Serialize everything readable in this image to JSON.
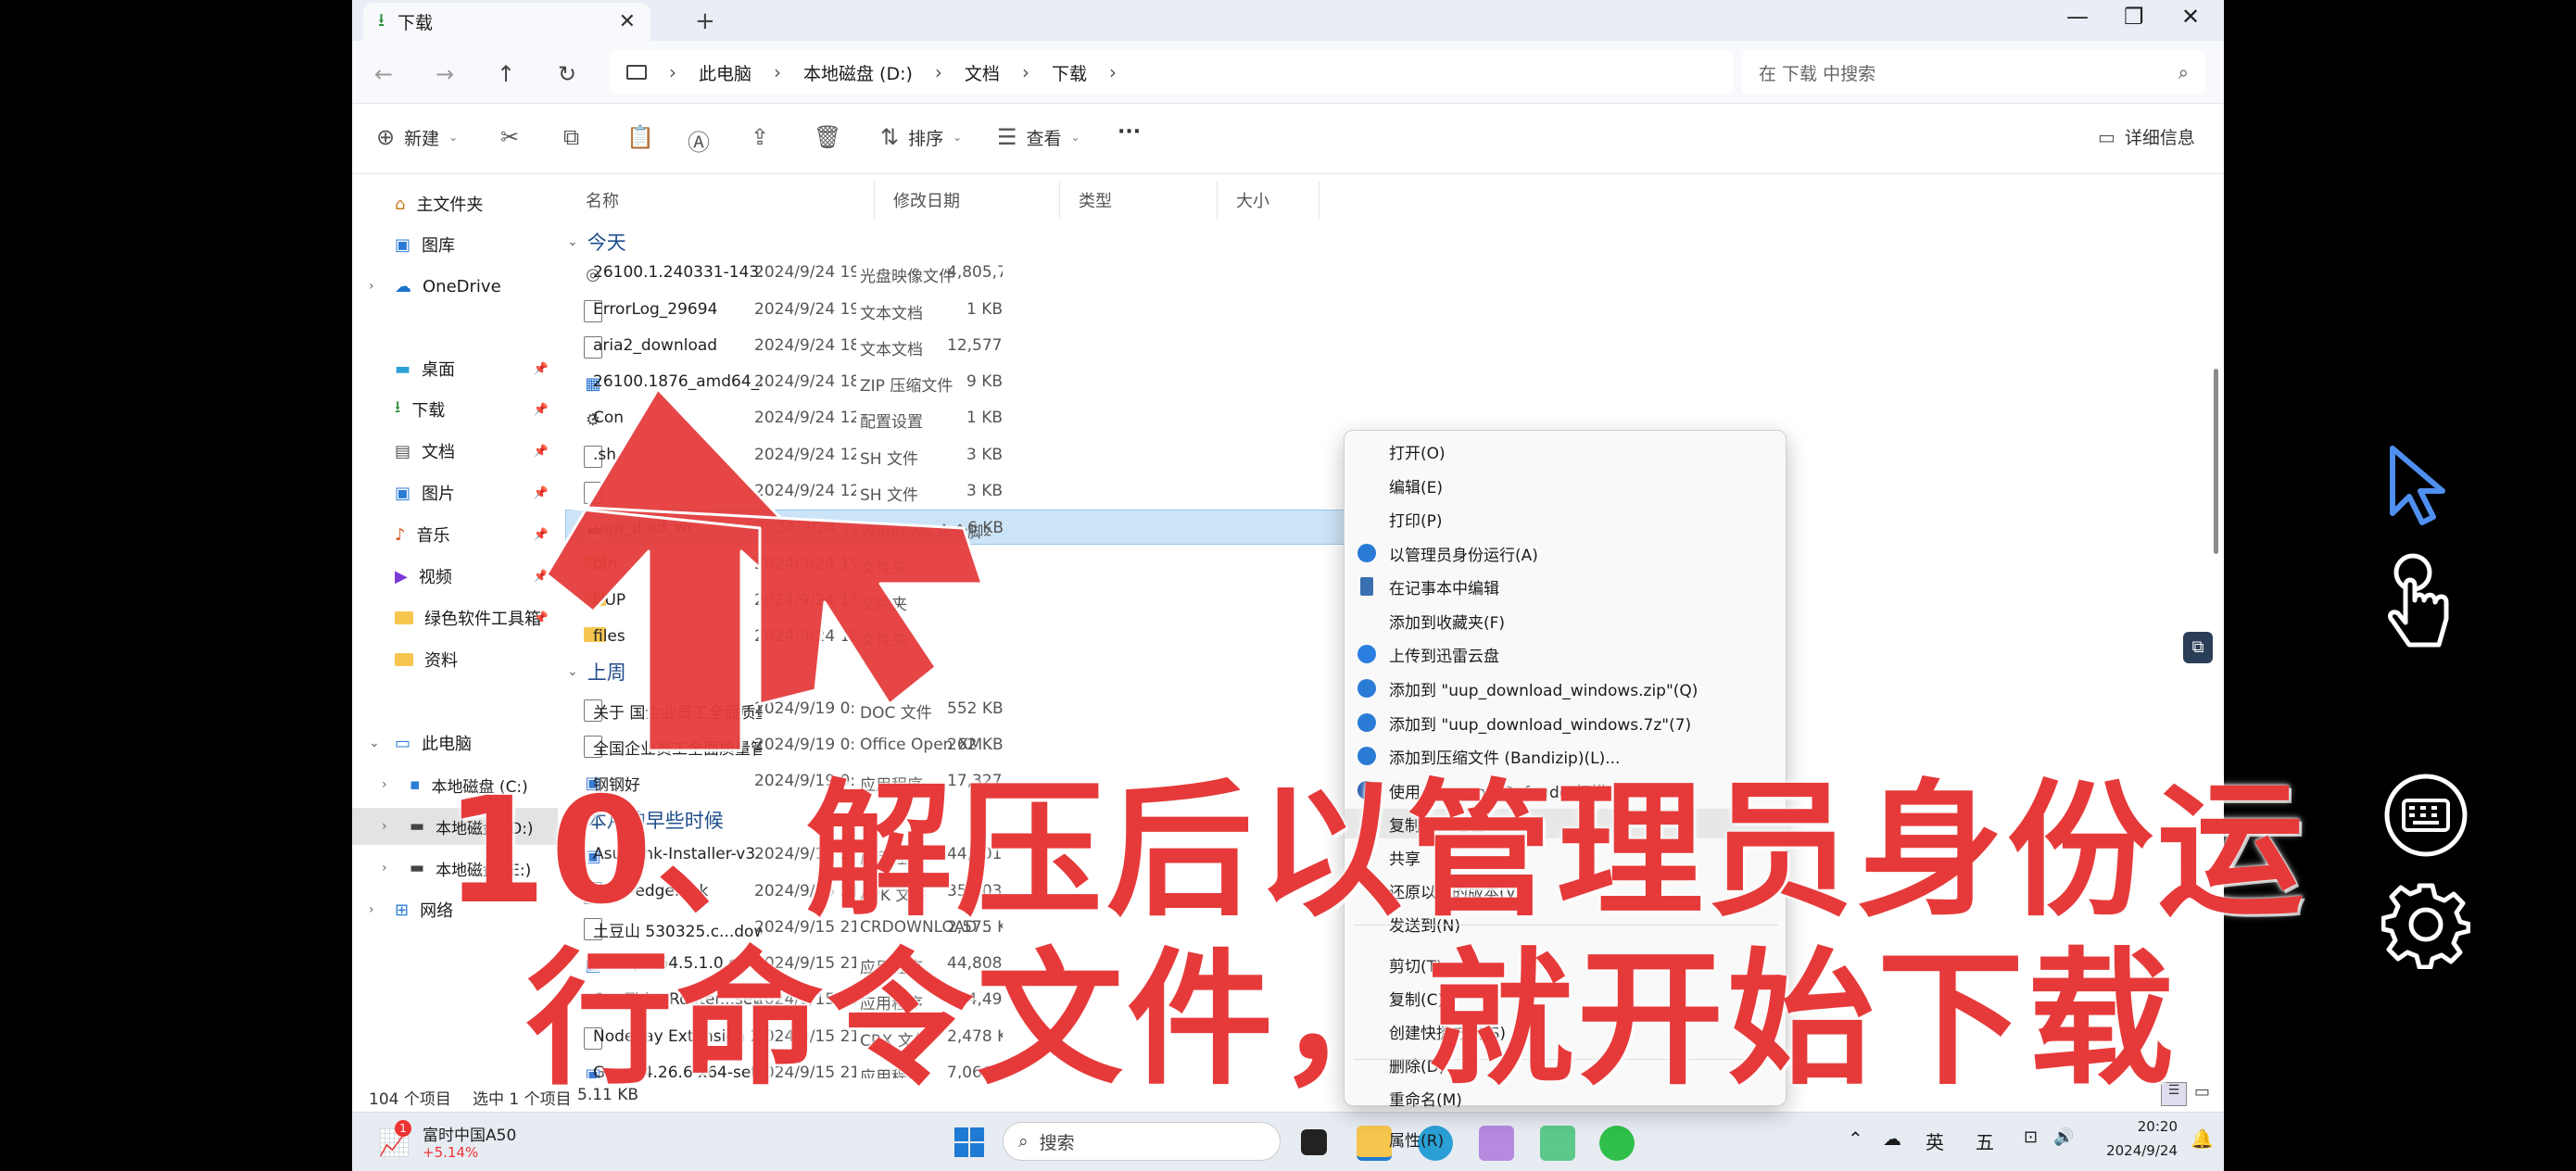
{
  "tab": {
    "title": "下载",
    "close": "✕",
    "new": "+"
  },
  "window_controls": {
    "minimize": "—",
    "maximize": "❐",
    "close": "✕"
  },
  "breadcrumb": [
    "此电脑",
    "本地磁盘 (D:)",
    "文档",
    "下载"
  ],
  "search": {
    "placeholder": "在 下载 中搜索"
  },
  "commands": {
    "new": "新建",
    "sort": "排序",
    "view": "查看",
    "more": "···",
    "details": "详细信息"
  },
  "sidebar": {
    "items": [
      {
        "label": "主文件夹",
        "icon": "home-icon"
      },
      {
        "label": "图库",
        "icon": "gallery-icon"
      },
      {
        "label": "OneDrive",
        "icon": "cloud-icon"
      },
      {
        "label": "桌面",
        "icon": "desktop-icon"
      },
      {
        "label": "下载",
        "icon": "download-icon"
      },
      {
        "label": "文档",
        "icon": "document-icon"
      },
      {
        "label": "图片",
        "icon": "picture-icon"
      },
      {
        "label": "音乐",
        "icon": "music-icon"
      },
      {
        "label": "视频",
        "icon": "video-icon"
      },
      {
        "label": "绿色软件工具箱",
        "icon": "folder-icon"
      },
      {
        "label": "资料",
        "icon": "folder-icon"
      },
      {
        "label": "此电脑",
        "icon": "pc-icon"
      },
      {
        "label": "本地磁盘 (C:)",
        "icon": "drive-icon"
      },
      {
        "label": "本地磁盘 (D:)",
        "icon": "drive-icon"
      },
      {
        "label": "本地磁盘 (E:)",
        "icon": "drive-icon"
      },
      {
        "label": "网络",
        "icon": "network-icon"
      }
    ]
  },
  "columns": {
    "name": "名称",
    "date": "修改日期",
    "type": "类型",
    "size": "大小"
  },
  "groups": {
    "today": "今天",
    "last_week": "上周",
    "earlier": "本月的早些时候"
  },
  "files": [
    {
      "name": "26100.1.240331-1435.GE_RELEASE_CL...",
      "date": "2024/9/24 19:13",
      "type": "光盘映像文件",
      "size": "4,805,720..."
    },
    {
      "name": "ErrorLog_29694",
      "date": "2024/9/24 19:02",
      "type": "文本文档",
      "size": "1 KB"
    },
    {
      "name": "aria2_download",
      "date": "2024/9/24 18:23",
      "type": "文本文档",
      "size": "12,577 KB"
    },
    {
      "name": "26100.1876_amd64_zh-cn_multi_009c...",
      "date": "2024/9/24 18:14",
      "type": "ZIP 压缩文件",
      "size": "9 KB"
    },
    {
      "name": "Con",
      "date": "2024/9/24 12:14",
      "type": "配置设置",
      "size": "1 KB"
    },
    {
      "name": ".sh",
      "date": "2024/9/24 12:14",
      "type": "SH 文件",
      "size": "3 KB"
    },
    {
      "name": "",
      "date": "2024/9/24 12:14",
      "type": "SH 文件",
      "size": "3 KB"
    },
    {
      "name": "uup_d   ad_wi",
      "date": "2024/9/24 12:14",
      "type": "Windows 命令脚本",
      "size": "6 KB"
    },
    {
      "name": "bin",
      "date": "2024/9/24 19:13",
      "type": "文件夹",
      "size": ""
    },
    {
      "name": "UUP",
      "date": "2024/9/24 18:31",
      "type": "文件夹",
      "size": ""
    },
    {
      "name": "files",
      "date": "2024/9/24 18:19",
      "type": "文件夹",
      "size": ""
    },
    {
      "name": "关于  国企业员工全面质量管理知识",
      "date": "2024/9/19 0:28",
      "type": "DOC 文件",
      "size": "552 KB"
    },
    {
      "name": "全国企业员工全面质量管理知识竞赛复习",
      "date": "2024/9/19 0:28",
      "type": "Office Open XM...",
      "size": "262 KB"
    },
    {
      "name": "钢钢好",
      "date": "2024/9/19 0:14",
      "type": "应用程序",
      "size": "17,327 KB"
    },
    {
      "name": "AsusLink-Installer-v3.5...",
      "date": "2024/9/15 22:54",
      "type": "应用程序",
      "size": "44,701 KB"
    },
    {
      "name": "titan-edge.apk",
      "date": "2024/9/15 21:52",
      "type": "APK 文件",
      "size": "359,033 KB"
    },
    {
      "name": "土豆山 530325.c...download",
      "date": "2024/9/15 21:58",
      "type": "CRDOWNLOAD ...",
      "size": "2,575 KB"
    },
    {
      "name": "tsetup-x64.5.1.0.exe",
      "date": "2024/9/15 21:44",
      "type": "应用程序",
      "size": "44,808 KB"
    },
    {
      "name": "OneThingRouter...setup_pc-One...",
      "date": "2024/9/15 21:18",
      "type": "应用程序",
      "size": "224,492 KB"
    },
    {
      "name": "Nodepay Extension 2.2.7.crx",
      "date": "2024/9/15 21:12",
      "type": "CRX 文件",
      "size": "2,478 KB"
    },
    {
      "name": "Grass 4.26.6 x64-setup",
      "date": "2024/9/15 21:03",
      "type": "应用程序",
      "size": "7,066 KB"
    }
  ],
  "status": {
    "count": "104 个项目",
    "selected": "选中 1 个项目",
    "size": "5.11 KB"
  },
  "context_menu": [
    {
      "label": "打开(O)",
      "icon": ""
    },
    {
      "label": "编辑(E)",
      "icon": ""
    },
    {
      "label": "打印(P)",
      "icon": ""
    },
    {
      "label": "以管理员身份运行(A)",
      "icon": "shield-icon"
    },
    {
      "label": "在记事本中编辑",
      "icon": "notepad-icon"
    },
    {
      "label": "添加到收藏夹(F)",
      "icon": ""
    },
    {
      "label": "上传到迅雷云盘",
      "icon": "thunder-icon"
    },
    {
      "label": "添加到 \"uup_download_windows.zip\"(Q)",
      "icon": "bandizip-icon"
    },
    {
      "label": "添加到 \"uup_download_windows.7z\"(7)",
      "icon": "bandizip-icon"
    },
    {
      "label": "添加到压缩文件 (Bandizip)(L)...",
      "icon": "bandizip-icon"
    },
    {
      "label": "使用 Microsoft Defender扫描...",
      "icon": "defender-icon"
    },
    {
      "label": "复制文件地址",
      "icon": ""
    },
    {
      "label": "共享",
      "icon": ""
    },
    {
      "label": "还原以前的版本(V)",
      "icon": ""
    },
    {
      "label": "发送到(N)",
      "icon": ""
    },
    {
      "label": "剪切(T)",
      "icon": ""
    },
    {
      "label": "复制(C)",
      "icon": ""
    },
    {
      "label": "创建快捷方式(S)",
      "icon": ""
    },
    {
      "label": "删除(D)",
      "icon": ""
    },
    {
      "label": "重命名(M)",
      "icon": ""
    },
    {
      "label": "属性(R)",
      "icon": ""
    }
  ],
  "overlay": {
    "line1": "10、解压后以管理员身份运",
    "line2": "行命令文件，就开始下载"
  },
  "taskbar": {
    "stock_name": "富时中国A50",
    "stock_change": "+5.14%",
    "stock_badge": "1",
    "search": "搜索",
    "ime1": "英",
    "ime2": "五",
    "time": "20:20",
    "date": "2024/9/24"
  },
  "colors": {
    "overlay_red": "#e63a3a",
    "selection": "#cce4f7",
    "accent": "#0067c0"
  }
}
